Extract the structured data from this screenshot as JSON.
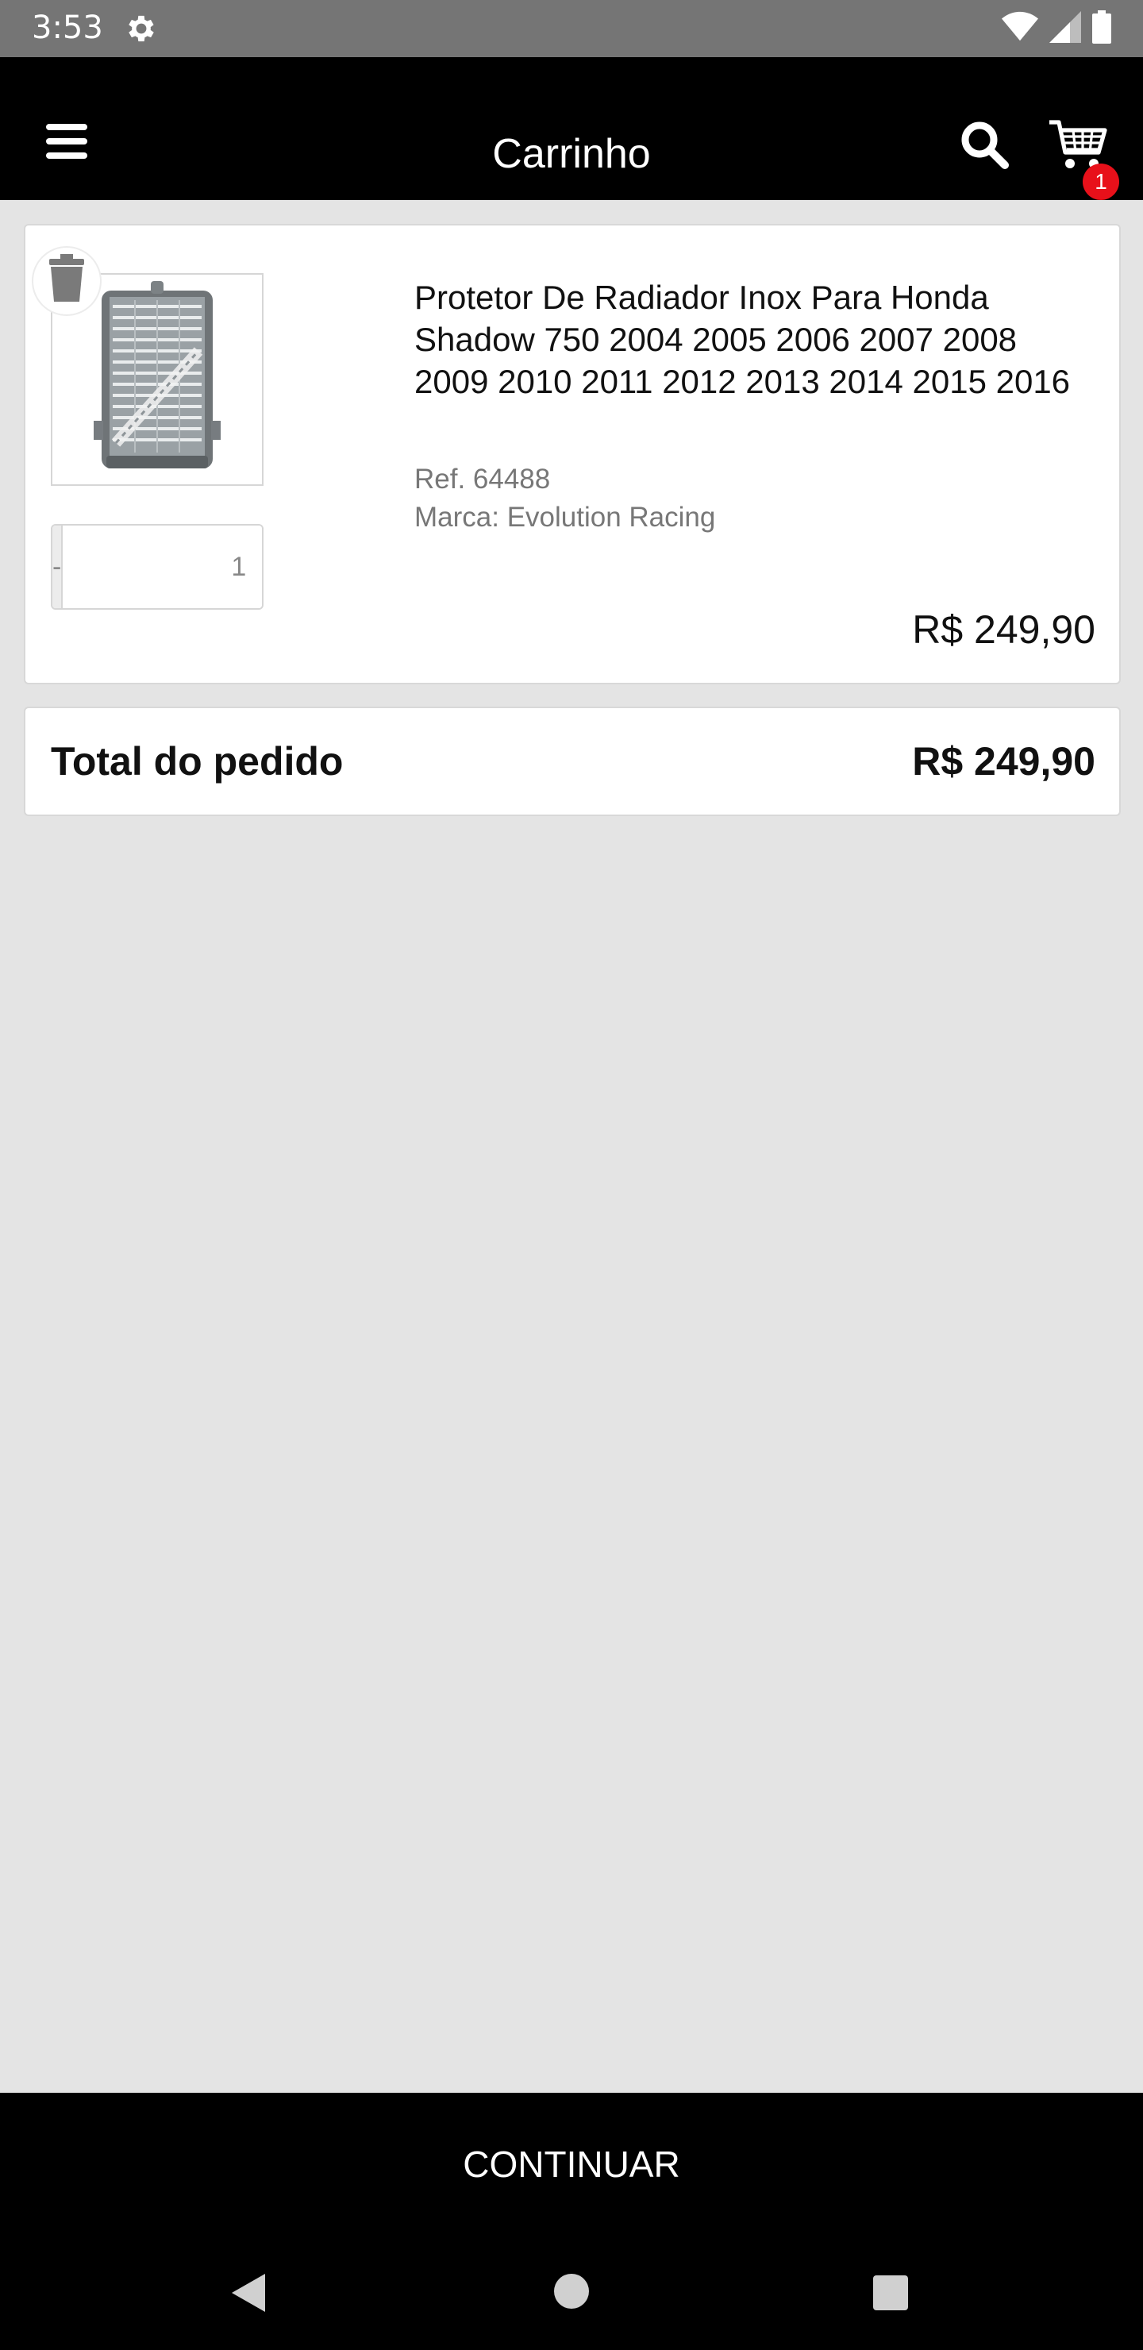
{
  "status_bar": {
    "time": "3:53",
    "icons": [
      "gear-icon",
      "wifi-icon",
      "signal-icon",
      "battery-icon"
    ]
  },
  "app_bar": {
    "title": "Carrinho",
    "cart_badge": "1"
  },
  "cart_item": {
    "name": "Protetor De Radiador Inox Para Honda Shadow 750 2004 2005 2006 2007 2008 2009 2010 2011 2012 2013 2014 2015 2016",
    "ref": "Ref. 64488",
    "brand": "Marca: Evolution Racing",
    "price": "R$ 249,90",
    "quantity": "1",
    "minus_label": "-",
    "plus_label": "+"
  },
  "order_total": {
    "label": "Total do pedido",
    "value": "R$ 249,90"
  },
  "continue_button": {
    "label": "CONTINUAR"
  },
  "colors": {
    "badge": "#e8101a",
    "app_bar": "#000000",
    "background": "#e4e4e4",
    "status_bar": "#757575"
  }
}
